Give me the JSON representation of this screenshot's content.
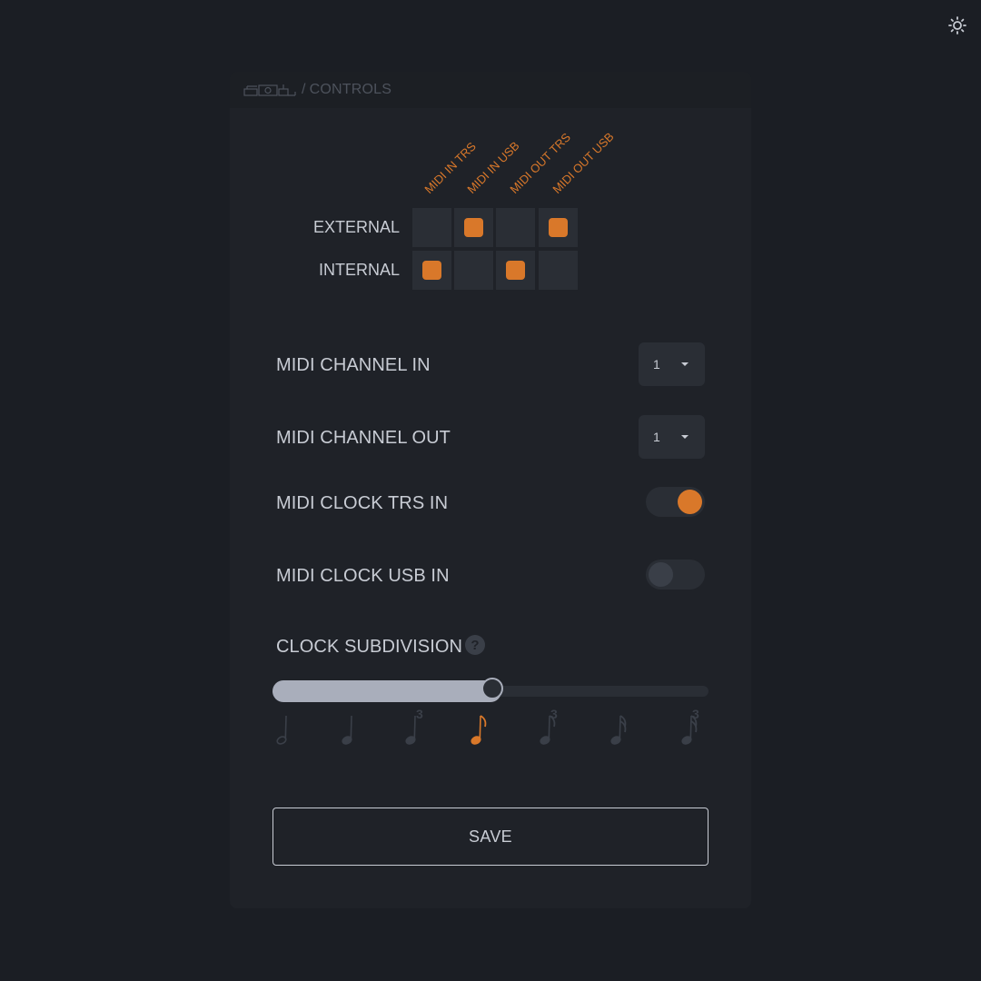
{
  "header": {
    "device_icon": "device-icon",
    "separator": "/",
    "title": "CONTROLS"
  },
  "theme_icon": "sun-icon",
  "routing": {
    "columns": [
      "MIDI IN TRS",
      "MIDI IN USB",
      "MIDI OUT TRS",
      "MIDI OUT USB"
    ],
    "rows": [
      {
        "label": "EXTERNAL",
        "cells": [
          false,
          true,
          false,
          true
        ]
      },
      {
        "label": "INTERNAL",
        "cells": [
          true,
          false,
          true,
          false
        ]
      }
    ]
  },
  "settings": {
    "midi_channel_in": {
      "label": "MIDI CHANNEL IN",
      "value": "1"
    },
    "midi_channel_out": {
      "label": "MIDI CHANNEL OUT",
      "value": "1"
    },
    "midi_clock_trs_in": {
      "label": "MIDI CLOCK TRS IN",
      "on": true
    },
    "midi_clock_usb_in": {
      "label": "MIDI CLOCK USB IN",
      "on": false
    }
  },
  "clock_subdivision": {
    "label": "CLOCK SUBDIVISION",
    "help_icon": "question-icon",
    "selected_index": 3,
    "steps": [
      {
        "icon": "half-note-icon",
        "triplet": ""
      },
      {
        "icon": "quarter-note-icon",
        "triplet": ""
      },
      {
        "icon": "quarter-note-triplet-icon",
        "triplet": "3"
      },
      {
        "icon": "eighth-note-icon",
        "triplet": ""
      },
      {
        "icon": "eighth-note-triplet-icon",
        "triplet": "3"
      },
      {
        "icon": "sixteenth-note-icon",
        "triplet": ""
      },
      {
        "icon": "sixteenth-note-triplet-icon",
        "triplet": "3"
      }
    ]
  },
  "save_label": "SAVE",
  "colors": {
    "accent": "#d9782a",
    "background": "#1b1e24",
    "panel": "#1f2228",
    "cell": "#2a2e35",
    "muted": "#4d525c"
  }
}
